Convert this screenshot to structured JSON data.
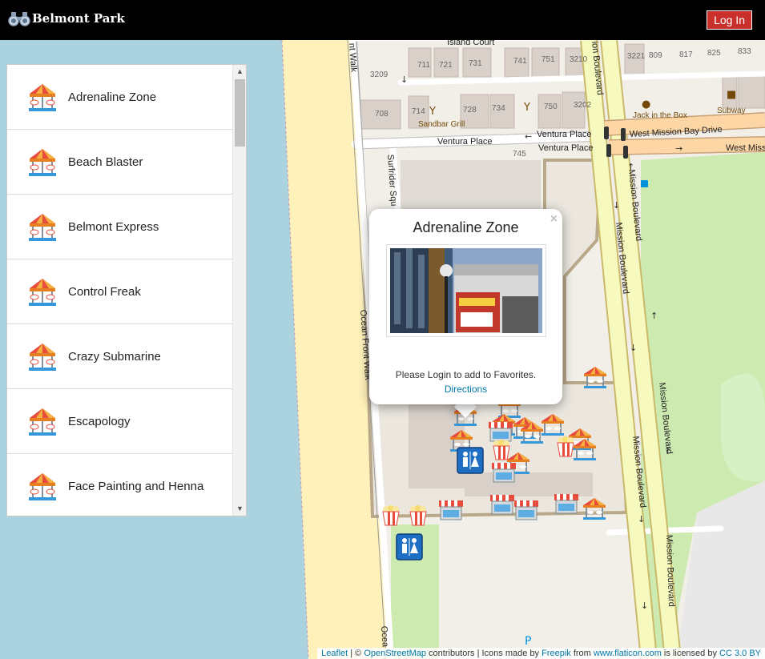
{
  "header": {
    "brand": "Belmont Park",
    "login_label": "Log In"
  },
  "attractions": [
    {
      "label": "Adrenaline Zone",
      "icon": "carousel-icon"
    },
    {
      "label": "Beach Blaster",
      "icon": "carousel-icon"
    },
    {
      "label": "Belmont Express",
      "icon": "carousel-icon"
    },
    {
      "label": "Control Freak",
      "icon": "carousel-icon"
    },
    {
      "label": "Crazy Submarine",
      "icon": "carousel-icon"
    },
    {
      "label": "Escapology",
      "icon": "carousel-icon"
    },
    {
      "label": "Face Painting and Henna",
      "icon": "carousel-icon"
    }
  ],
  "popup": {
    "title": "Adrenaline Zone",
    "close": "×",
    "message": "Please Login to add to Favorites.",
    "directions": "Directions"
  },
  "map_labels": {
    "island_court": "Island Court",
    "ventura_place": "Ventura Place",
    "ventura_place_2": "Ventura Place",
    "ventura_place_3": "Ventura Place",
    "west_mission_bay": "West Mission Bay Drive",
    "west_miss": "West Miss",
    "mission_blvd_1": "Mission Boulevard",
    "mission_blvd_2": "Mission Boulevard",
    "mission_blvd_3": "Mission Boulevard",
    "mission_blvd_4": "Mission Boulevard",
    "mission_blvd_5": "Mission Boulevard",
    "ion_blvd": "ion Boulevard",
    "surfrider": "Surfrider Squ",
    "ocean_front_walk": "Ocean Front Walk",
    "ocean_front_walk_2": "nt Walk",
    "ocean_bottom": "Ocea",
    "sandbar": "Sandbar Grill",
    "jack": "Jack in the Box",
    "subway": "Subway",
    "parking": "P",
    "house_numbers": [
      "711",
      "721",
      "731",
      "741",
      "751",
      "3210",
      "3221",
      "809",
      "817",
      "825",
      "833",
      "3209",
      "708",
      "714",
      "728",
      "734",
      "750",
      "3202",
      "745"
    ]
  },
  "attribution": {
    "leaflet": "Leaflet",
    "sep": " | © ",
    "osm": "OpenStreetMap",
    "contributors": " contributors | Icons made by ",
    "freepik": "Freepik",
    "from": " from ",
    "flaticon": "www.flaticon.com",
    "licensed": " is licensed by ",
    "cc": "CC 3.0 BY"
  },
  "colors": {
    "header_bg": "#000000",
    "login_bg": "#c9302c",
    "water": "#aad3df",
    "sand": "#fff1ba",
    "park": "#cdebb0",
    "primary_road": "#f7fabf",
    "secondary_road": "#fcd6a4",
    "link": "#0078a8"
  }
}
